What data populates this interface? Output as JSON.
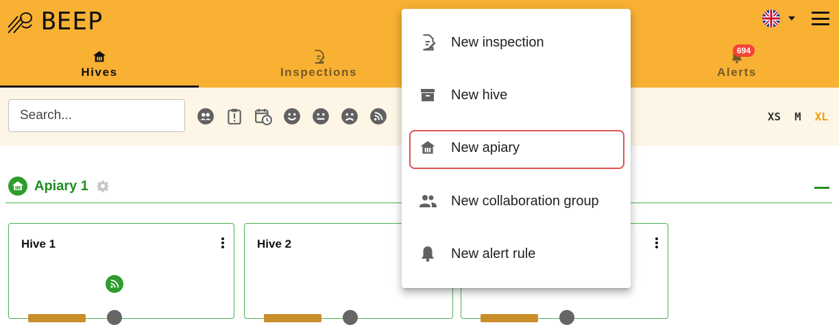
{
  "app": {
    "title": "BEEP"
  },
  "tabs": [
    {
      "label": "Hives",
      "icon": "apiary-icon",
      "active": true
    },
    {
      "label": "Inspections",
      "icon": "inspection-icon",
      "active": false
    },
    {
      "label": "Alerts",
      "icon": "bell-icon",
      "active": false,
      "badge": "694"
    }
  ],
  "toolbar": {
    "search_placeholder": "Search...",
    "filters": [
      "group-filter-icon",
      "clipboard-alert-icon",
      "calendar-clock-icon",
      "happy-face-icon",
      "neutral-face-icon",
      "sad-face-icon",
      "sensor-icon"
    ],
    "sizes": [
      {
        "label": "XS",
        "active": false
      },
      {
        "label": "M",
        "active": false
      },
      {
        "label": "XL",
        "active": true
      }
    ]
  },
  "apiary": {
    "title": "Apiary 1",
    "hives": [
      {
        "name": "Hive 1"
      },
      {
        "name": "Hive 2"
      },
      {
        "name": ""
      }
    ]
  },
  "menu": {
    "items": [
      {
        "label": "New inspection",
        "icon": "inspection-edit-icon"
      },
      {
        "label": "New hive",
        "icon": "hive-box-icon"
      },
      {
        "label": "New apiary",
        "icon": "apiary-icon",
        "highlighted": true
      },
      {
        "label": "New collaboration group",
        "icon": "group-icon"
      },
      {
        "label": "New alert rule",
        "icon": "bell-icon"
      }
    ]
  },
  "colors": {
    "appbar": "#f8b133",
    "toolbar": "#fdf6e6",
    "apiary_green": "#1e8e1e",
    "badge_red": "#f44336",
    "size_active": "#f29c00",
    "highlight": "#d9534f"
  }
}
